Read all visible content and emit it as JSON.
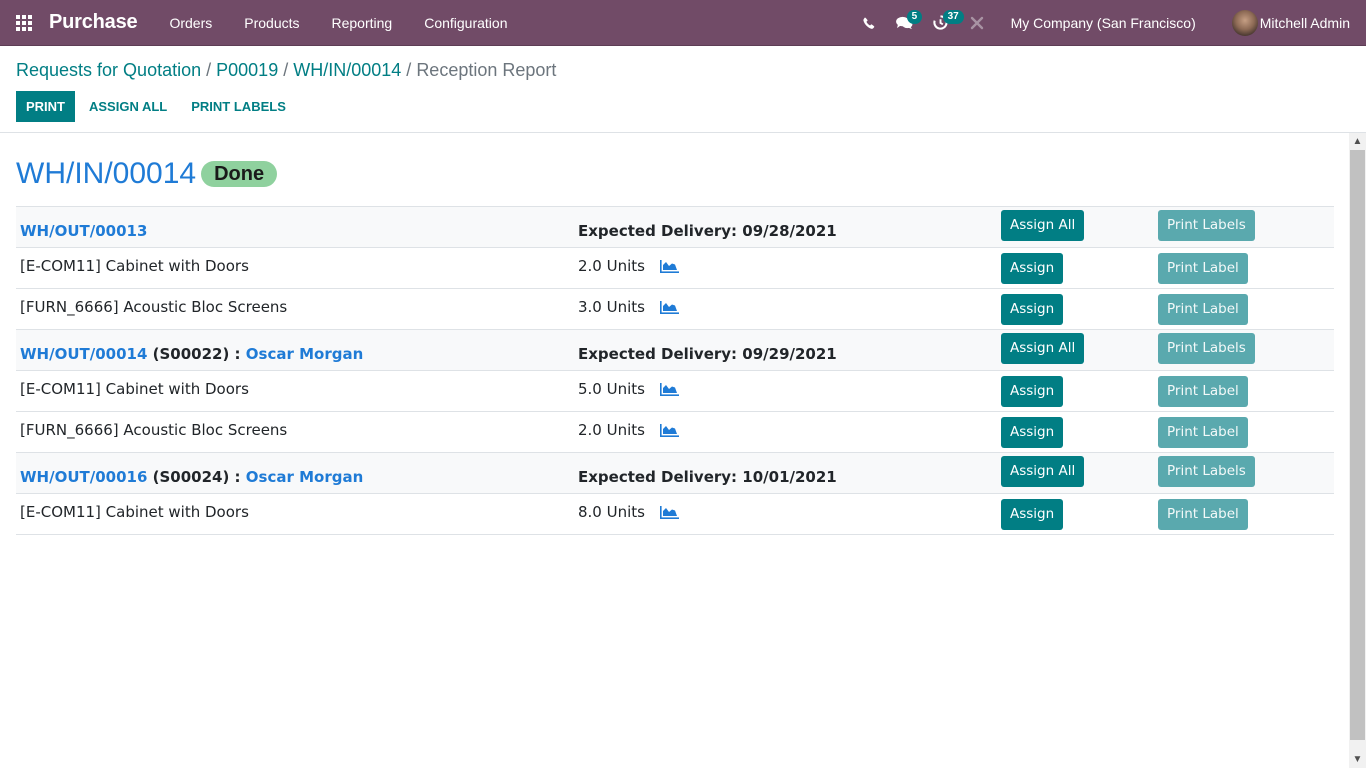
{
  "navbar": {
    "app_name": "Purchase",
    "menu": [
      "Orders",
      "Products",
      "Reporting",
      "Configuration"
    ],
    "icons": {
      "apps": "apps-grid-icon",
      "phone": "phone-icon",
      "messages": "chat-icon",
      "activities": "clock-icon",
      "debug": "tools-icon"
    },
    "messages_count": "5",
    "activities_count": "37",
    "company": "My Company (San Francisco)",
    "user": "Mitchell Admin"
  },
  "breadcrumb": {
    "items": [
      "Requests for Quotation",
      "P00019",
      "WH/IN/00014"
    ],
    "separator": "/",
    "current": "Reception Report"
  },
  "actions": {
    "print": "PRINT",
    "assign_all": "ASSIGN ALL",
    "print_labels": "PRINT LABELS"
  },
  "document": {
    "title": "WH/IN/00014",
    "status": "Done"
  },
  "colors": {
    "navbar": "#714B67",
    "primary": "#017e84",
    "link": "#1f7bd6",
    "status_done": "#8fd19e"
  },
  "groups": [
    {
      "picking": "WH/OUT/00013",
      "origin": "",
      "partner": "",
      "expected_delivery": "Expected Delivery: 09/28/2021",
      "assign_all_label": "Assign All",
      "print_labels_label": "Print Labels",
      "lines": [
        {
          "product": "[E-COM11] Cabinet with Doors",
          "quantity": "2.0 Units",
          "assign_label": "Assign",
          "print_label": "Print Label"
        },
        {
          "product": "[FURN_6666] Acoustic Bloc Screens",
          "quantity": "3.0 Units",
          "assign_label": "Assign",
          "print_label": "Print Label"
        }
      ]
    },
    {
      "picking": "WH/OUT/00014",
      "origin": "(S00022) :",
      "partner": "Oscar Morgan",
      "expected_delivery": "Expected Delivery: 09/29/2021",
      "assign_all_label": "Assign All",
      "print_labels_label": "Print Labels",
      "lines": [
        {
          "product": "[E-COM11] Cabinet with Doors",
          "quantity": "5.0 Units",
          "assign_label": "Assign",
          "print_label": "Print Label"
        },
        {
          "product": "[FURN_6666] Acoustic Bloc Screens",
          "quantity": "2.0 Units",
          "assign_label": "Assign",
          "print_label": "Print Label"
        }
      ]
    },
    {
      "picking": "WH/OUT/00016",
      "origin": "(S00024) :",
      "partner": "Oscar Morgan",
      "expected_delivery": "Expected Delivery: 10/01/2021",
      "assign_all_label": "Assign All",
      "print_labels_label": "Print Labels",
      "lines": [
        {
          "product": "[E-COM11] Cabinet with Doors",
          "quantity": "8.0 Units",
          "assign_label": "Assign",
          "print_label": "Print Label"
        }
      ]
    }
  ]
}
